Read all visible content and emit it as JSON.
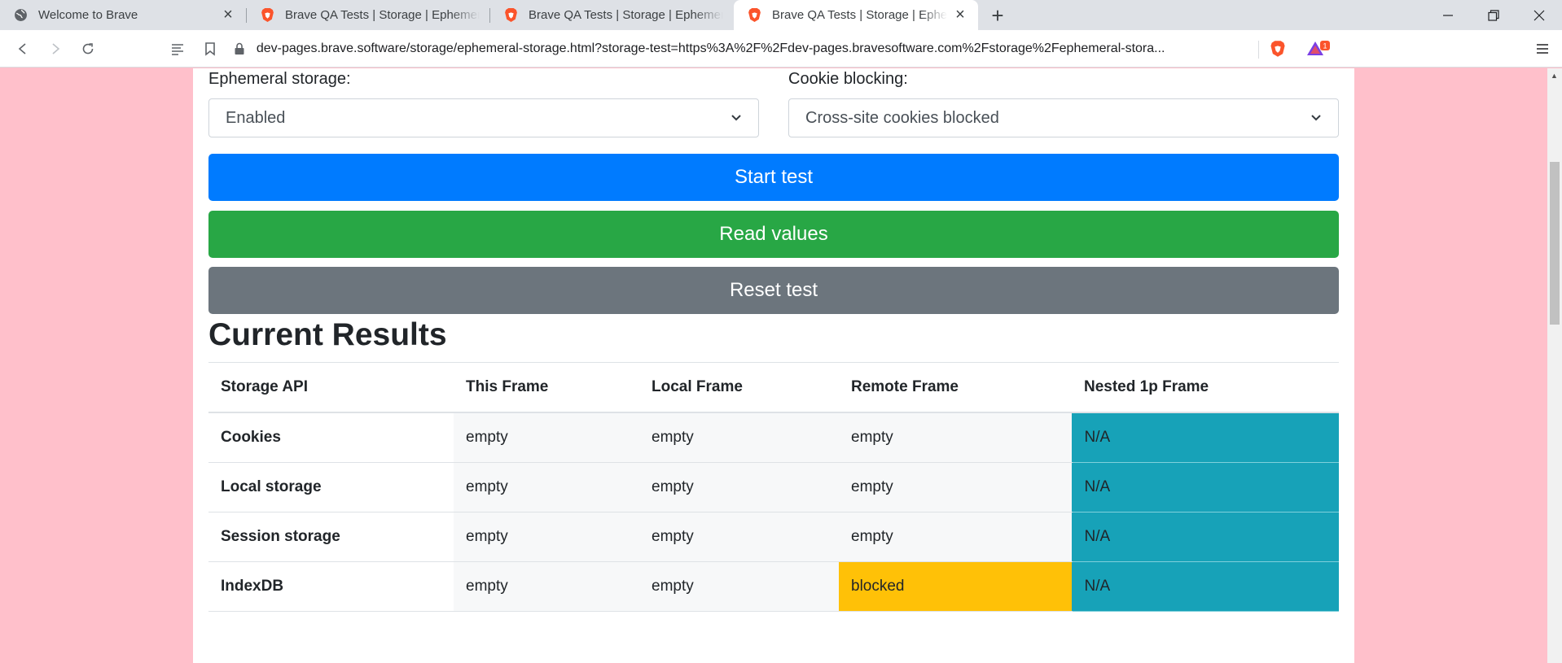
{
  "browser": {
    "tabs": [
      {
        "title": "Welcome to Brave",
        "icon": "globe-icon"
      },
      {
        "title": "Brave QA Tests | Storage | Ephemeral S",
        "icon": "brave-lion-icon"
      },
      {
        "title": "Brave QA Tests | Storage | Ephemeral S",
        "icon": "brave-lion-icon"
      },
      {
        "title": "Brave QA Tests | Storage | Epheme",
        "icon": "brave-lion-icon",
        "active": true
      }
    ],
    "address": "dev-pages.brave.software/storage/ephemeral-storage.html?storage-test=https%3A%2F%2Fdev-pages.bravesoftware.com%2Fstorage%2Fephemeral-stora...",
    "rewards_badge": "1"
  },
  "form": {
    "ephemeral_label": "Ephemeral storage:",
    "ephemeral_value": "Enabled",
    "cookie_label": "Cookie blocking:",
    "cookie_value": "Cross-site cookies blocked"
  },
  "buttons": {
    "start": "Start test",
    "read": "Read values",
    "reset": "Reset test"
  },
  "results": {
    "heading": "Current Results",
    "columns": [
      "Storage API",
      "This Frame",
      "Local Frame",
      "Remote Frame",
      "Nested 1p Frame"
    ],
    "rows": [
      {
        "api": "Cookies",
        "this": "empty",
        "local": "empty",
        "remote": "empty",
        "nested": "N/A"
      },
      {
        "api": "Local storage",
        "this": "empty",
        "local": "empty",
        "remote": "empty",
        "nested": "N/A"
      },
      {
        "api": "Session storage",
        "this": "empty",
        "local": "empty",
        "remote": "empty",
        "nested": "N/A"
      },
      {
        "api": "IndexDB",
        "this": "empty",
        "local": "empty",
        "remote": "blocked",
        "nested": "N/A"
      }
    ]
  },
  "colors": {
    "page_bg": "#ffc0cb",
    "primary": "#007bff",
    "success": "#28a745",
    "secondary": "#6c757d",
    "warning": "#ffc107",
    "info": "#17a2b8"
  }
}
